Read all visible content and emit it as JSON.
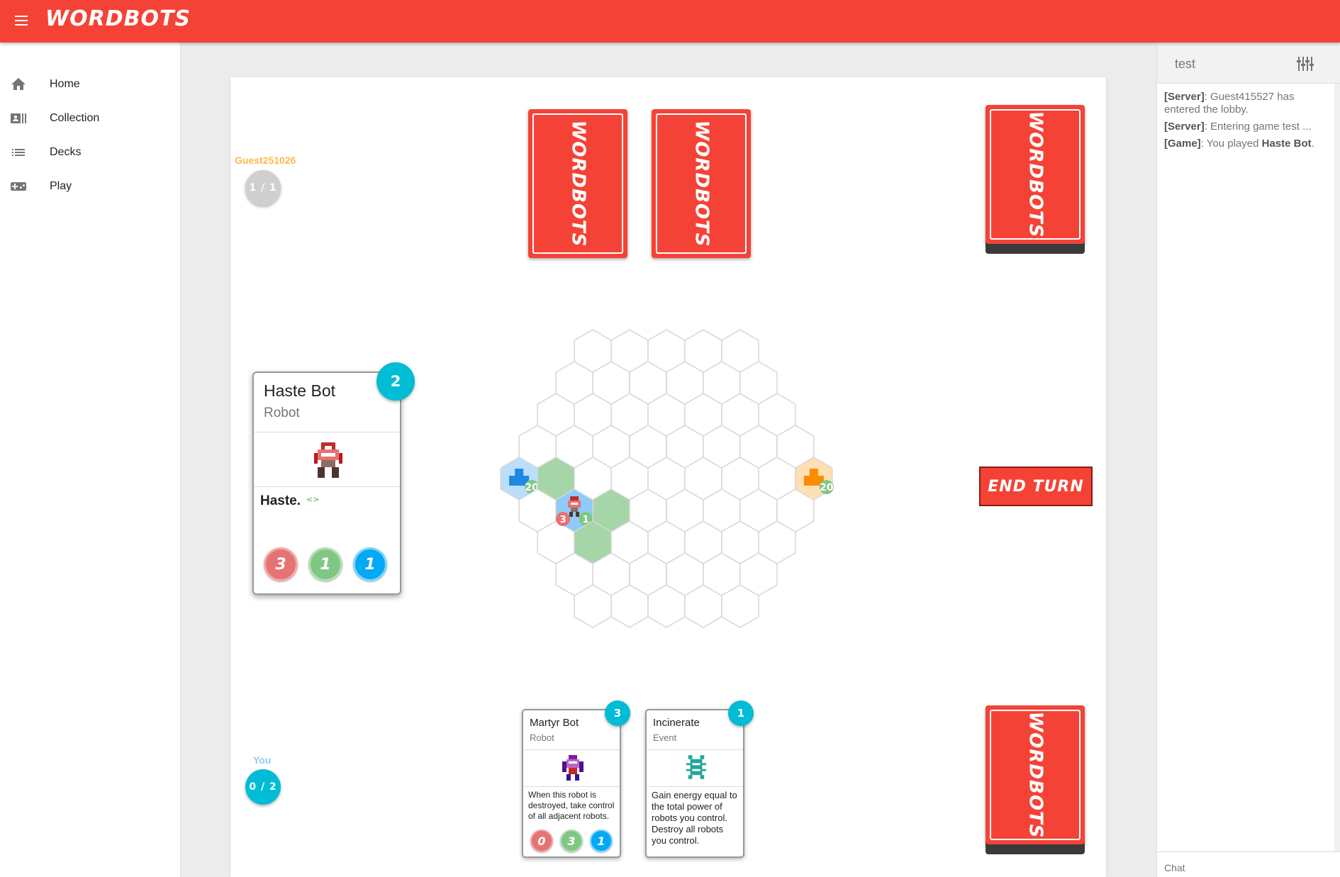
{
  "app": {
    "brand": "WORDBOTS"
  },
  "nav": {
    "items": [
      {
        "label": "Home",
        "icon": "home-icon"
      },
      {
        "label": "Collection",
        "icon": "collection-icon"
      },
      {
        "label": "Decks",
        "icon": "decks-icon"
      },
      {
        "label": "Play",
        "icon": "gamepad-icon"
      }
    ]
  },
  "deck_back_text": "WORDBOTS",
  "opponent": {
    "name": "Guest251026",
    "energy": "1 / 1",
    "color": "#ffb74d"
  },
  "player": {
    "name": "You",
    "energy": "0 / 2",
    "color": "#90caf9"
  },
  "selected_card": {
    "name": "Haste Bot",
    "type": "Robot",
    "text": "Haste.",
    "keyword_marker": "<>",
    "cost": "2",
    "attack": "3",
    "health": "1",
    "speed": "1"
  },
  "hand": [
    {
      "name": "Martyr Bot",
      "type": "Robot",
      "text": "When this robot is destroyed, take control of all adjacent robots.",
      "cost": "3",
      "attack": "0",
      "health": "3",
      "speed": "1"
    },
    {
      "name": "Incinerate",
      "type": "Event",
      "text": "Gain energy equal to the total power of robots you control. Destroy all robots you control.",
      "cost": "1"
    }
  ],
  "board": {
    "blue_core_health": "20",
    "orange_core_health": "20",
    "robot_attack": "3",
    "robot_health": "1"
  },
  "end_turn_label": "END TURN",
  "chat": {
    "room": "test",
    "messages": [
      {
        "source": "[Server]",
        "text": ": Guest415527 has entered the lobby."
      },
      {
        "source": "[Server]",
        "text": ": Entering game test ..."
      },
      {
        "source": "[Game]",
        "text": ": You played ",
        "bold": "Haste Bot",
        "end": "."
      }
    ],
    "input_placeholder": "Chat"
  },
  "colors": {
    "accent": "#f44336",
    "cost": "#00bcd4",
    "attack": "#e57373",
    "health": "#81c784",
    "speed": "#03a9f4"
  }
}
